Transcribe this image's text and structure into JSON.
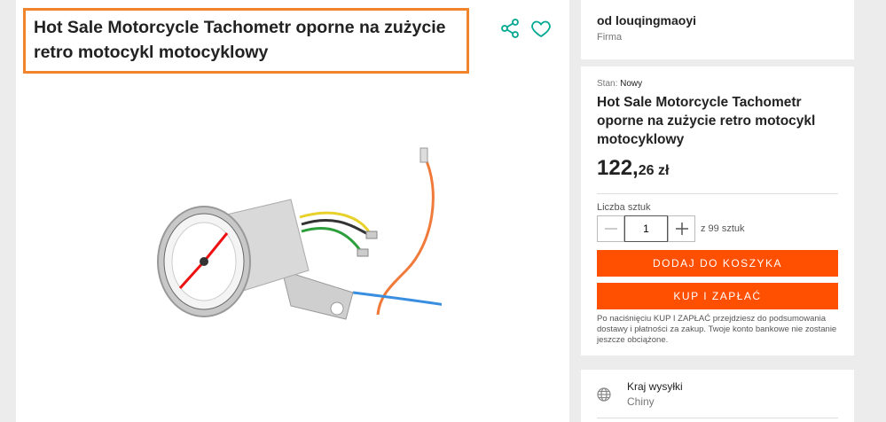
{
  "product": {
    "title": "Hot Sale Motorcycle Tachometr oporne na zużycie retro motocykl motocyklowy"
  },
  "icons": {
    "share": "share-icon",
    "favorite": "heart-icon",
    "globe": "globe-icon"
  },
  "seller": {
    "name": "od louqingmaoyi",
    "type": "Firma"
  },
  "offer": {
    "condition_label": "Stan:",
    "condition_value": "Nowy",
    "title": "Hot Sale Motorcycle Tachometr oporne na zużycie retro motocykl motocyklowy",
    "price_int": "122,",
    "price_dec": "26 zł",
    "quantity_label": "Liczba sztuk",
    "quantity_value": "1",
    "quantity_of": "z 99 sztuk",
    "add_to_cart": "DODAJ DO KOSZYKA",
    "buy_now": "KUP I ZAPŁAĆ",
    "disclaimer": "Po naciśnięciu KUP I ZAPŁAĆ przejdziesz do podsumowania dostawy i płatności za zakup. Twoje konto bankowe nie zostanie jeszcze obciążone."
  },
  "shipping": {
    "label": "Kraj wysyłki",
    "value": "Chiny"
  },
  "colors": {
    "accent": "#ff4f00",
    "teal": "#00a790",
    "highlight": "#f0852d"
  }
}
